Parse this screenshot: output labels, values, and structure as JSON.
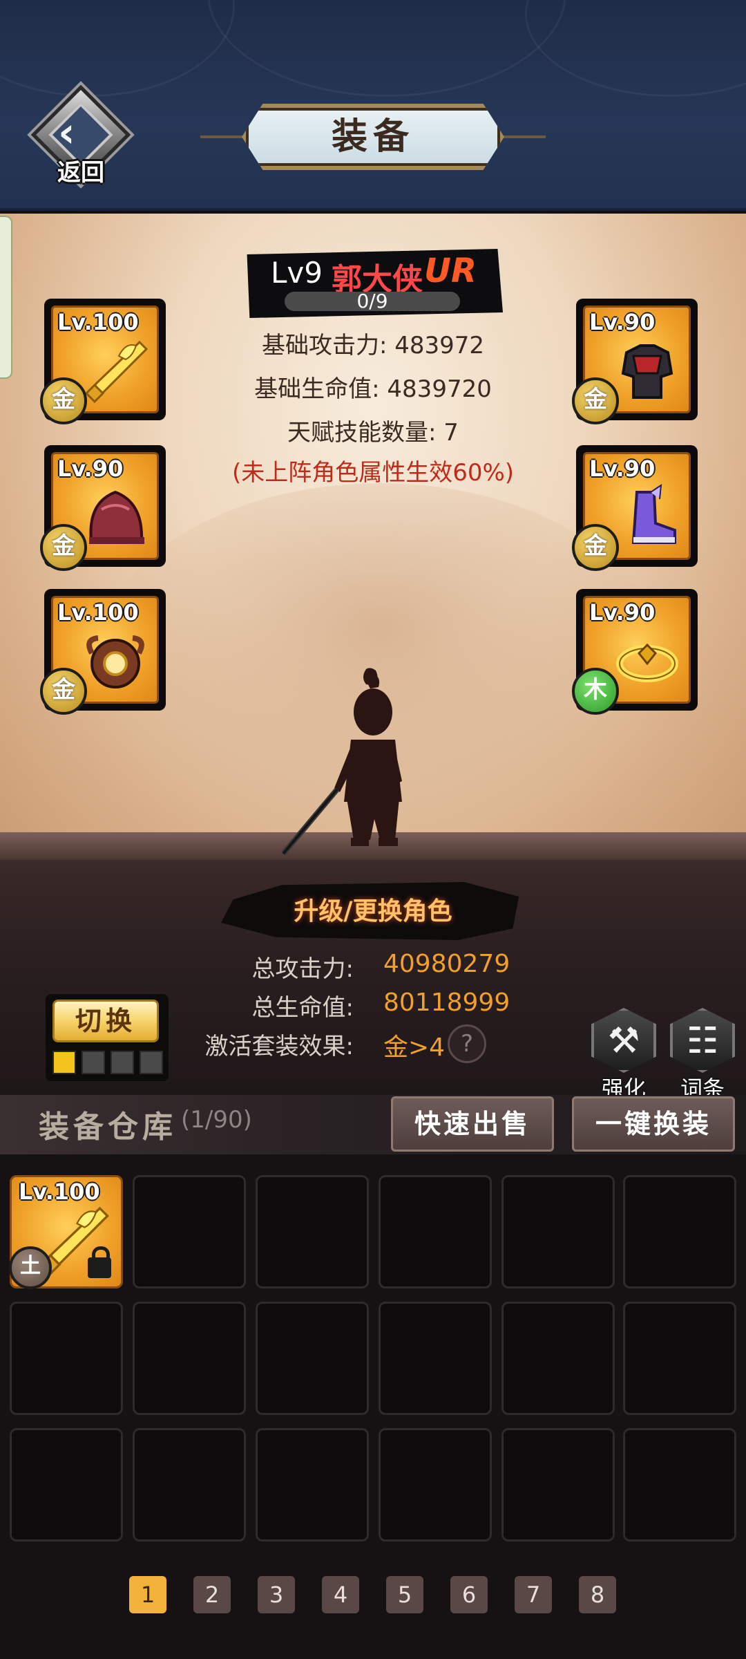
{
  "header": {
    "back_label": "返回",
    "title": "装备"
  },
  "character": {
    "level": "Lv9",
    "name": "郭大侠",
    "rarity": "UR",
    "progress": "0/9",
    "stats": [
      "基础攻击力: 483972",
      "基础生命值: 4839720",
      "天赋技能数量: 7"
    ],
    "note": "(未上阵角色属性生效60%)"
  },
  "equipment_slots": [
    {
      "level": "Lv.100",
      "element": "金",
      "element_type": "gold",
      "item_icon": "golden-dragon-sword-icon"
    },
    {
      "level": "Lv.90",
      "element": "金",
      "element_type": "gold",
      "item_icon": "red-helmet-icon"
    },
    {
      "level": "Lv.100",
      "element": "金",
      "element_type": "gold",
      "item_icon": "bronze-amulet-icon"
    },
    {
      "level": "Lv.90",
      "element": "金",
      "element_type": "gold",
      "item_icon": "dark-armor-icon"
    },
    {
      "level": "Lv.90",
      "element": "金",
      "element_type": "gold",
      "item_icon": "purple-boots-icon"
    },
    {
      "level": "Lv.90",
      "element": "木",
      "element_type": "wood",
      "item_icon": "gold-ring-icon"
    }
  ],
  "upgrade_label": "升级/更换角色",
  "totals": {
    "attack_label": "总攻击力:",
    "attack_value": "40980279",
    "hp_label": "总生命值:",
    "hp_value": "80118999",
    "set_label": "激活套装效果:",
    "set_value": "金>4",
    "help": "?"
  },
  "switch": {
    "label": "切换",
    "active_index": 0,
    "count": 4
  },
  "tools": {
    "enhance_label": "强化",
    "affix_label": "词条"
  },
  "storage": {
    "title": "装备仓库",
    "count": "(1/90)",
    "quick_sell": "快速出售",
    "one_click_equip": "一键换装",
    "items": [
      {
        "level": "Lv.100",
        "element": "土",
        "element_type": "earth",
        "locked": true,
        "item_icon": "golden-dragon-sword-icon"
      }
    ],
    "total_cells": 18
  },
  "pagination": {
    "pages": [
      "1",
      "2",
      "3",
      "4",
      "5",
      "6",
      "7",
      "8"
    ],
    "active": "1"
  },
  "colors": {
    "accent_gold": "#f3b23a",
    "stat_orange": "#f2a02a",
    "name_red": "#ff4848",
    "note_red": "#bf2b1b"
  }
}
